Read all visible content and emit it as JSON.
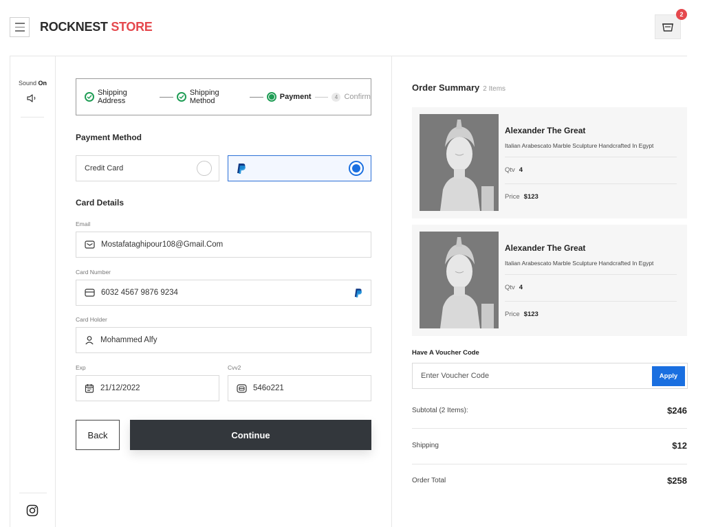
{
  "header": {
    "brand_part1": "ROCKNEST",
    "brand_part2": "STORE",
    "cart_count": "2"
  },
  "rail": {
    "sound_label": "Sound",
    "sound_state": "On"
  },
  "stepper": {
    "steps": [
      {
        "label": "Shipping Address",
        "state": "done"
      },
      {
        "label": "Shipping Method",
        "state": "done"
      },
      {
        "label": "Payment",
        "state": "current"
      },
      {
        "label": "Confirm",
        "state": "pending",
        "number": "4"
      }
    ]
  },
  "payment": {
    "title": "Payment Method",
    "options": [
      {
        "label": "Credit Card",
        "selected": false
      },
      {
        "label": "PayPal",
        "selected": true
      }
    ]
  },
  "card": {
    "title": "Card Details",
    "email_label": "Email",
    "email_value": "Mostafataghipour108@Gmail.Com",
    "number_label": "Card Number",
    "number_value": "6032  4567  9876  9234",
    "holder_label": "Card Holder",
    "holder_value": "Mohammed Alfy",
    "exp_label": "Exp",
    "exp_value": "21/12/2022",
    "cvv_label": "Cvv2",
    "cvv_value": "546o221"
  },
  "actions": {
    "back_label": "Back",
    "continue_label": "Continue"
  },
  "summary": {
    "title": "Order Summary",
    "count": "2 Items",
    "items": [
      {
        "name": "Alexander The Great",
        "desc": "Italian Arabescato Marble Sculpture Handcrafted In Egypt",
        "qty_label": "Qtv",
        "qty": "4",
        "price_label": "Price",
        "price": "$123"
      },
      {
        "name": "Alexander The Great",
        "desc": "Italian Arabescato Marble Sculpture Handcrafted In Egypt",
        "qty_label": "Qtv",
        "qty": "4",
        "price_label": "Price",
        "price": "$123"
      }
    ],
    "voucher_label": "Have A Voucher Code",
    "voucher_placeholder": "Enter Voucher Code",
    "apply_label": "Apply",
    "subtotal_label": "Subtotal (2 Items):",
    "subtotal_value": "$246",
    "shipping_label": "Shipping",
    "shipping_value": "$12",
    "total_label": "Order Total",
    "total_value": "$258"
  },
  "colors": {
    "accent_blue": "#1a6fe0",
    "brand_red": "#e5484d",
    "success_green": "#1f9d55",
    "dark_button": "#33373c"
  }
}
